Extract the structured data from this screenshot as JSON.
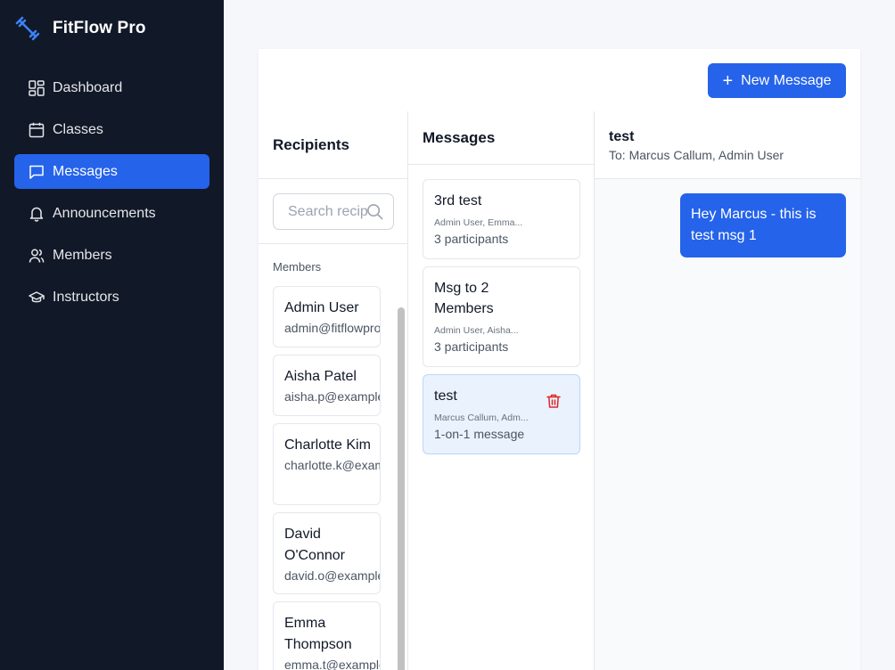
{
  "app": {
    "name": "FitFlow Pro"
  },
  "sidebar": {
    "items": [
      {
        "label": "Dashboard",
        "icon": "dashboard-icon",
        "active": false
      },
      {
        "label": "Classes",
        "icon": "calendar-icon",
        "active": false
      },
      {
        "label": "Messages",
        "icon": "message-icon",
        "active": true
      },
      {
        "label": "Announcements",
        "icon": "bell-icon",
        "active": false
      },
      {
        "label": "Members",
        "icon": "users-icon",
        "active": false
      },
      {
        "label": "Instructors",
        "icon": "graduation-cap-icon",
        "active": false
      }
    ]
  },
  "toolbar": {
    "new_message_label": "New Message"
  },
  "recipients": {
    "title": "Recipients",
    "search_placeholder": "Search recipients",
    "section_label": "Members",
    "items": [
      {
        "name": "Admin User",
        "email": "admin@fitflowpro.com"
      },
      {
        "name": "Aisha Patel",
        "email": "aisha.p@example.com"
      },
      {
        "name": "Charlotte Kim",
        "email": "charlotte.k@example.com"
      },
      {
        "name": "David O'Connor",
        "email": "david.o@example.com"
      },
      {
        "name": "Emma Thompson",
        "email": "emma.t@example.com"
      }
    ]
  },
  "messages": {
    "title": "Messages",
    "items": [
      {
        "title": "3rd test",
        "names": "Admin User, Emma...",
        "count": "3 participants"
      },
      {
        "title": "Msg to 2 Members",
        "names": "Admin User, Aisha...",
        "count": "3 participants"
      },
      {
        "title": "test",
        "names": "Marcus Callum, Adm...",
        "count": "1-on-1 message"
      }
    ]
  },
  "thread": {
    "title": "test",
    "to": "To: Marcus Callum, Admin User",
    "messages": [
      {
        "text": "Hey Marcus - this is test msg 1"
      }
    ]
  },
  "colors": {
    "sidebar_bg": "#111827",
    "accent": "#2563eb",
    "selected_bg": "#eaf2fd",
    "danger": "#dc2626"
  }
}
